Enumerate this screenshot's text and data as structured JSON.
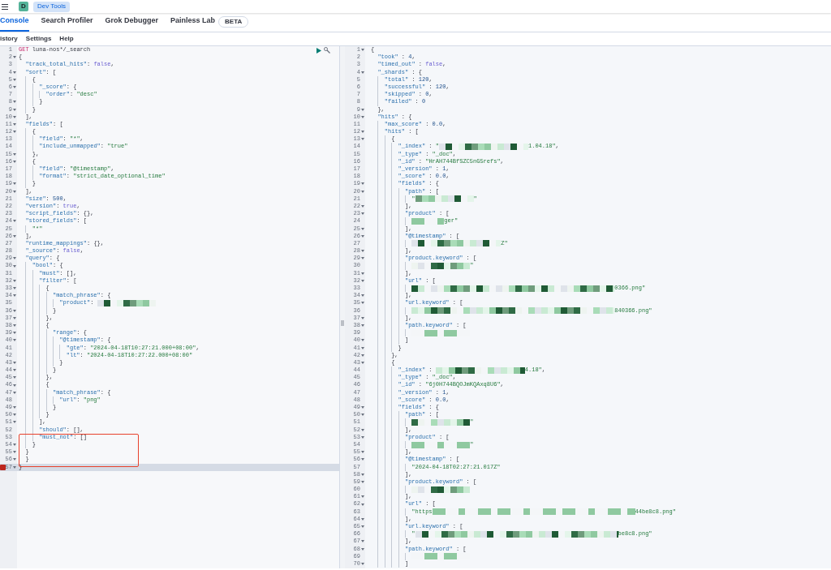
{
  "header": {
    "avatar": "D",
    "breadcrumb": "Dev Tools"
  },
  "tabs": [
    {
      "label": "Console",
      "selected": true
    },
    {
      "label": "Search Profiler",
      "selected": false
    },
    {
      "label": "Grok Debugger",
      "selected": false
    },
    {
      "label": "Painless Lab",
      "selected": false,
      "badge": "BETA"
    }
  ],
  "menu": [
    "istory",
    "Settings",
    "Help"
  ],
  "request_editor": {
    "lines": [
      {
        "n": "1",
        "fold": false,
        "active": false,
        "error": false,
        "boxed": false,
        "tokens": [
          {
            "kind": "meth",
            "text": "GET"
          },
          {
            "kind": "path",
            "text": " luna-nos*/_search"
          }
        ]
      },
      {
        "n": "2",
        "fold": true,
        "active": false,
        "error": false,
        "boxed": false,
        "tokens": [
          {
            "kind": "pun",
            "text": "{"
          }
        ]
      },
      {
        "n": "3",
        "fold": false,
        "active": false,
        "error": false,
        "boxed": false,
        "tokens": [
          {
            "kind": "key",
            "text": "  \"track_total_hits\""
          },
          {
            "kind": "pun",
            "text": ": "
          },
          {
            "kind": "kw",
            "text": "false"
          },
          {
            "kind": "pun",
            "text": ","
          }
        ]
      },
      {
        "n": "4",
        "fold": true,
        "active": false,
        "error": false,
        "boxed": false,
        "tokens": [
          {
            "kind": "key",
            "text": "  \"sort\""
          },
          {
            "kind": "pun",
            "text": ": ["
          }
        ]
      },
      {
        "n": "5",
        "fold": true,
        "active": false,
        "error": false,
        "boxed": false,
        "tokens": [
          {
            "kind": "pun",
            "text": "    {"
          }
        ]
      },
      {
        "n": "6",
        "fold": true,
        "active": false,
        "error": false,
        "boxed": false,
        "tokens": [
          {
            "kind": "key",
            "text": "      \"_score\""
          },
          {
            "kind": "pun",
            "text": ": {"
          }
        ]
      },
      {
        "n": "7",
        "fold": false,
        "active": false,
        "error": false,
        "boxed": false,
        "tokens": [
          {
            "kind": "key",
            "text": "        \"order\""
          },
          {
            "kind": "pun",
            "text": ": "
          },
          {
            "kind": "str",
            "text": "\"desc\""
          }
        ]
      },
      {
        "n": "8",
        "fold": true,
        "active": false,
        "error": false,
        "boxed": false,
        "tokens": [
          {
            "kind": "pun",
            "text": "      }"
          }
        ]
      },
      {
        "n": "9",
        "fold": true,
        "active": false,
        "error": false,
        "boxed": false,
        "tokens": [
          {
            "kind": "pun",
            "text": "    }"
          }
        ]
      },
      {
        "n": "10",
        "fold": true,
        "active": false,
        "error": false,
        "boxed": false,
        "tokens": [
          {
            "kind": "pun",
            "text": "  ],"
          }
        ]
      },
      {
        "n": "11",
        "fold": true,
        "active": false,
        "error": false,
        "boxed": false,
        "tokens": [
          {
            "kind": "key",
            "text": "  \"fields\""
          },
          {
            "kind": "pun",
            "text": ": ["
          }
        ]
      },
      {
        "n": "12",
        "fold": true,
        "active": false,
        "error": false,
        "boxed": false,
        "tokens": [
          {
            "kind": "pun",
            "text": "    {"
          }
        ]
      },
      {
        "n": "13",
        "fold": false,
        "active": false,
        "error": false,
        "boxed": false,
        "tokens": [
          {
            "kind": "key",
            "text": "      \"field\""
          },
          {
            "kind": "pun",
            "text": ": "
          },
          {
            "kind": "str",
            "text": "\"*\""
          },
          {
            "kind": "pun",
            "text": ","
          }
        ]
      },
      {
        "n": "14",
        "fold": false,
        "active": false,
        "error": false,
        "boxed": false,
        "tokens": [
          {
            "kind": "key",
            "text": "      \"include_unmapped\""
          },
          {
            "kind": "pun",
            "text": ": "
          },
          {
            "kind": "str",
            "text": "\"true\""
          }
        ]
      },
      {
        "n": "15",
        "fold": true,
        "active": false,
        "error": false,
        "boxed": false,
        "tokens": [
          {
            "kind": "pun",
            "text": "    },"
          }
        ]
      },
      {
        "n": "16",
        "fold": true,
        "active": false,
        "error": false,
        "boxed": false,
        "tokens": [
          {
            "kind": "pun",
            "text": "    {"
          }
        ]
      },
      {
        "n": "17",
        "fold": false,
        "active": false,
        "error": false,
        "boxed": false,
        "tokens": [
          {
            "kind": "key",
            "text": "      \"field\""
          },
          {
            "kind": "pun",
            "text": ": "
          },
          {
            "kind": "str",
            "text": "\"@timestamp\""
          },
          {
            "kind": "pun",
            "text": ","
          }
        ]
      },
      {
        "n": "18",
        "fold": false,
        "active": false,
        "error": false,
        "boxed": false,
        "tokens": [
          {
            "kind": "key",
            "text": "      \"format\""
          },
          {
            "kind": "pun",
            "text": ": "
          },
          {
            "kind": "str",
            "text": "\"strict_date_optional_time\""
          }
        ]
      },
      {
        "n": "19",
        "fold": true,
        "active": false,
        "error": false,
        "boxed": false,
        "tokens": [
          {
            "kind": "pun",
            "text": "    }"
          }
        ]
      },
      {
        "n": "20",
        "fold": true,
        "active": false,
        "error": false,
        "boxed": false,
        "tokens": [
          {
            "kind": "pun",
            "text": "  ],"
          }
        ]
      },
      {
        "n": "21",
        "fold": false,
        "active": false,
        "error": false,
        "boxed": false,
        "tokens": [
          {
            "kind": "key",
            "text": "  \"size\""
          },
          {
            "kind": "pun",
            "text": ": "
          },
          {
            "kind": "num",
            "text": "500"
          },
          {
            "kind": "pun",
            "text": ","
          }
        ]
      },
      {
        "n": "22",
        "fold": false,
        "active": false,
        "error": false,
        "boxed": false,
        "tokens": [
          {
            "kind": "key",
            "text": "  \"version\""
          },
          {
            "kind": "pun",
            "text": ": "
          },
          {
            "kind": "kw",
            "text": "true"
          },
          {
            "kind": "pun",
            "text": ","
          }
        ]
      },
      {
        "n": "23",
        "fold": false,
        "active": false,
        "error": false,
        "boxed": false,
        "tokens": [
          {
            "kind": "key",
            "text": "  \"script_fields\""
          },
          {
            "kind": "pun",
            "text": ": {},"
          }
        ]
      },
      {
        "n": "24",
        "fold": true,
        "active": false,
        "error": false,
        "boxed": false,
        "tokens": [
          {
            "kind": "key",
            "text": "  \"stored_fields\""
          },
          {
            "kind": "pun",
            "text": ": ["
          }
        ]
      },
      {
        "n": "25",
        "fold": false,
        "active": false,
        "error": false,
        "boxed": false,
        "tokens": [
          {
            "kind": "str",
            "text": "    \"*\""
          }
        ]
      },
      {
        "n": "26",
        "fold": true,
        "active": false,
        "error": false,
        "boxed": false,
        "tokens": [
          {
            "kind": "pun",
            "text": "  ],"
          }
        ]
      },
      {
        "n": "27",
        "fold": false,
        "active": false,
        "error": false,
        "boxed": false,
        "tokens": [
          {
            "kind": "key",
            "text": "  \"runtime_mappings\""
          },
          {
            "kind": "pun",
            "text": ": {},"
          }
        ]
      },
      {
        "n": "28",
        "fold": false,
        "active": false,
        "error": false,
        "boxed": false,
        "tokens": [
          {
            "kind": "key",
            "text": "  \"_source\""
          },
          {
            "kind": "pun",
            "text": ": "
          },
          {
            "kind": "kw",
            "text": "false"
          },
          {
            "kind": "pun",
            "text": ","
          }
        ]
      },
      {
        "n": "29",
        "fold": true,
        "active": false,
        "error": false,
        "boxed": false,
        "tokens": [
          {
            "kind": "key",
            "text": "  \"query\""
          },
          {
            "kind": "pun",
            "text": ": {"
          }
        ]
      },
      {
        "n": "30",
        "fold": true,
        "active": false,
        "error": false,
        "boxed": false,
        "tokens": [
          {
            "kind": "key",
            "text": "    \"bool\""
          },
          {
            "kind": "pun",
            "text": ": {"
          }
        ]
      },
      {
        "n": "31",
        "fold": false,
        "active": false,
        "error": false,
        "boxed": false,
        "tokens": [
          {
            "kind": "key",
            "text": "      \"must\""
          },
          {
            "kind": "pun",
            "text": ": [],"
          }
        ]
      },
      {
        "n": "32",
        "fold": true,
        "active": false,
        "error": false,
        "boxed": false,
        "tokens": [
          {
            "kind": "key",
            "text": "      \"filter\""
          },
          {
            "kind": "pun",
            "text": ": ["
          }
        ]
      },
      {
        "n": "33",
        "fold": true,
        "active": false,
        "error": false,
        "boxed": false,
        "tokens": [
          {
            "kind": "pun",
            "text": "        {"
          }
        ]
      },
      {
        "n": "34",
        "fold": true,
        "active": false,
        "error": false,
        "boxed": false,
        "tokens": [
          {
            "kind": "key",
            "text": "          \"match_phrase\""
          },
          {
            "kind": "pun",
            "text": ": {"
          }
        ]
      },
      {
        "n": "35",
        "fold": false,
        "active": false,
        "error": false,
        "boxed": false,
        "tokens": [
          {
            "kind": "key",
            "text": "            \"product\""
          },
          {
            "kind": "pun",
            "text": ": "
          },
          {
            "kind": "mosaic_medium"
          }
        ]
      },
      {
        "n": "36",
        "fold": true,
        "active": false,
        "error": false,
        "boxed": false,
        "tokens": [
          {
            "kind": "pun",
            "text": "          }"
          }
        ]
      },
      {
        "n": "37",
        "fold": true,
        "active": false,
        "error": false,
        "boxed": false,
        "tokens": [
          {
            "kind": "pun",
            "text": "        },"
          }
        ]
      },
      {
        "n": "38",
        "fold": true,
        "active": false,
        "error": false,
        "boxed": false,
        "tokens": [
          {
            "kind": "pun",
            "text": "        {"
          }
        ]
      },
      {
        "n": "39",
        "fold": true,
        "active": false,
        "error": false,
        "boxed": false,
        "tokens": [
          {
            "kind": "key",
            "text": "          \"range\""
          },
          {
            "kind": "pun",
            "text": ": {"
          }
        ]
      },
      {
        "n": "40",
        "fold": true,
        "active": false,
        "error": false,
        "boxed": false,
        "tokens": [
          {
            "kind": "key",
            "text": "            \"@timestamp\""
          },
          {
            "kind": "pun",
            "text": ": {"
          }
        ]
      },
      {
        "n": "41",
        "fold": false,
        "active": false,
        "error": false,
        "boxed": false,
        "tokens": [
          {
            "kind": "key",
            "text": "              \"gte\""
          },
          {
            "kind": "pun",
            "text": ": "
          },
          {
            "kind": "str",
            "text": "\"2024-04-18T10:27:21.000+08:00\""
          },
          {
            "kind": "pun",
            "text": ","
          }
        ]
      },
      {
        "n": "42",
        "fold": false,
        "active": false,
        "error": false,
        "boxed": false,
        "tokens": [
          {
            "kind": "key",
            "text": "              \"lt\""
          },
          {
            "kind": "pun",
            "text": ": "
          },
          {
            "kind": "str",
            "text": "\"2024-04-18T10:27:22.000+08:00\""
          }
        ]
      },
      {
        "n": "43",
        "fold": true,
        "active": false,
        "error": false,
        "boxed": false,
        "tokens": [
          {
            "kind": "pun",
            "text": "            }"
          }
        ]
      },
      {
        "n": "44",
        "fold": true,
        "active": false,
        "error": false,
        "boxed": false,
        "tokens": [
          {
            "kind": "pun",
            "text": "          }"
          }
        ]
      },
      {
        "n": "45",
        "fold": true,
        "active": false,
        "error": false,
        "boxed": false,
        "tokens": [
          {
            "kind": "pun",
            "text": "        },"
          }
        ]
      },
      {
        "n": "46",
        "fold": true,
        "active": false,
        "error": false,
        "boxed": false,
        "tokens": [
          {
            "kind": "pun",
            "text": "        {"
          }
        ]
      },
      {
        "n": "47",
        "fold": true,
        "active": false,
        "error": false,
        "boxed": false,
        "tokens": [
          {
            "kind": "key",
            "text": "          \"match_phrase\""
          },
          {
            "kind": "pun",
            "text": ": {"
          }
        ]
      },
      {
        "n": "48",
        "fold": false,
        "active": false,
        "error": false,
        "boxed": false,
        "tokens": [
          {
            "kind": "key",
            "text": "            \"url\""
          },
          {
            "kind": "pun",
            "text": ": "
          },
          {
            "kind": "str",
            "text": "\"png\""
          }
        ]
      },
      {
        "n": "49",
        "fold": true,
        "active": false,
        "error": false,
        "boxed": false,
        "tokens": [
          {
            "kind": "pun",
            "text": "          }"
          }
        ]
      },
      {
        "n": "50",
        "fold": true,
        "active": false,
        "error": false,
        "boxed": false,
        "tokens": [
          {
            "kind": "pun",
            "text": "        }"
          }
        ]
      },
      {
        "n": "51",
        "fold": true,
        "active": false,
        "error": false,
        "boxed": false,
        "tokens": [
          {
            "kind": "pun",
            "text": "      ],"
          }
        ]
      },
      {
        "n": "52",
        "fold": false,
        "active": false,
        "error": false,
        "boxed": false,
        "tokens": [
          {
            "kind": "key",
            "text": "      \"should\""
          },
          {
            "kind": "pun",
            "text": ": [],"
          }
        ]
      },
      {
        "n": "53",
        "fold": false,
        "active": false,
        "error": false,
        "boxed": true,
        "tokens": [
          {
            "kind": "key",
            "text": "      \"must_not\""
          },
          {
            "kind": "pun",
            "text": ": []"
          }
        ]
      },
      {
        "n": "54",
        "fold": true,
        "active": false,
        "error": false,
        "boxed": true,
        "tokens": [
          {
            "kind": "pun",
            "text": "    }"
          }
        ]
      },
      {
        "n": "55",
        "fold": true,
        "active": false,
        "error": false,
        "boxed": true,
        "tokens": [
          {
            "kind": "pun",
            "text": "  }"
          }
        ]
      },
      {
        "n": "56",
        "fold": true,
        "active": false,
        "error": false,
        "boxed": true,
        "tokens": [
          {
            "kind": "pun",
            "text": "  }"
          }
        ]
      },
      {
        "n": "57",
        "fold": true,
        "active": true,
        "error": true,
        "boxed": false,
        "tokens": [
          {
            "kind": "pun",
            "text": "}"
          }
        ]
      }
    ]
  },
  "response_editor": {
    "lines": [
      {
        "n": "1",
        "fold": true,
        "tokens": [
          {
            "kind": "pun",
            "text": "{"
          }
        ]
      },
      {
        "n": "2",
        "fold": false,
        "tokens": [
          {
            "kind": "key",
            "text": "  \"took\""
          },
          {
            "kind": "pun",
            "text": " : "
          },
          {
            "kind": "num",
            "text": "4"
          },
          {
            "kind": "pun",
            "text": ","
          }
        ]
      },
      {
        "n": "3",
        "fold": false,
        "tokens": [
          {
            "kind": "key",
            "text": "  \"timed_out\""
          },
          {
            "kind": "pun",
            "text": " : "
          },
          {
            "kind": "kw",
            "text": "false"
          },
          {
            "kind": "pun",
            "text": ","
          }
        ]
      },
      {
        "n": "4",
        "fold": true,
        "tokens": [
          {
            "kind": "key",
            "text": "  \"_shards\""
          },
          {
            "kind": "pun",
            "text": " : {"
          }
        ]
      },
      {
        "n": "5",
        "fold": false,
        "tokens": [
          {
            "kind": "key",
            "text": "    \"total\""
          },
          {
            "kind": "pun",
            "text": " : "
          },
          {
            "kind": "num",
            "text": "120"
          },
          {
            "kind": "pun",
            "text": ","
          }
        ]
      },
      {
        "n": "6",
        "fold": false,
        "tokens": [
          {
            "kind": "key",
            "text": "    \"successful\""
          },
          {
            "kind": "pun",
            "text": " : "
          },
          {
            "kind": "num",
            "text": "120"
          },
          {
            "kind": "pun",
            "text": ","
          }
        ]
      },
      {
        "n": "7",
        "fold": false,
        "tokens": [
          {
            "kind": "key",
            "text": "    \"skipped\""
          },
          {
            "kind": "pun",
            "text": " : "
          },
          {
            "kind": "num",
            "text": "0"
          },
          {
            "kind": "pun",
            "text": ","
          }
        ]
      },
      {
        "n": "8",
        "fold": false,
        "tokens": [
          {
            "kind": "key",
            "text": "    \"failed\""
          },
          {
            "kind": "pun",
            "text": " : "
          },
          {
            "kind": "num",
            "text": "0"
          }
        ]
      },
      {
        "n": "9",
        "fold": true,
        "tokens": [
          {
            "kind": "pun",
            "text": "  },"
          }
        ]
      },
      {
        "n": "10",
        "fold": true,
        "tokens": [
          {
            "kind": "key",
            "text": "  \"hits\""
          },
          {
            "kind": "pun",
            "text": " : {"
          }
        ]
      },
      {
        "n": "11",
        "fold": false,
        "tokens": [
          {
            "kind": "key",
            "text": "    \"max_score\""
          },
          {
            "kind": "pun",
            "text": " : "
          },
          {
            "kind": "num",
            "text": "0.0"
          },
          {
            "kind": "pun",
            "text": ","
          }
        ]
      },
      {
        "n": "12",
        "fold": true,
        "tokens": [
          {
            "kind": "key",
            "text": "    \"hits\""
          },
          {
            "kind": "pun",
            "text": " : ["
          }
        ]
      },
      {
        "n": "13",
        "fold": true,
        "tokens": [
          {
            "kind": "pun",
            "text": "      {"
          }
        ]
      },
      {
        "n": "14",
        "fold": false,
        "tokens": [
          {
            "kind": "key",
            "text": "        \"_index\""
          },
          {
            "kind": "pun",
            "text": " : "
          },
          {
            "kind": "str",
            "text": "\""
          },
          {
            "kind": "mosaic_wide"
          },
          {
            "kind": "str",
            "text": "1.04.18\""
          },
          {
            "kind": "pun",
            "text": ","
          }
        ]
      },
      {
        "n": "15",
        "fold": false,
        "tokens": [
          {
            "kind": "key",
            "text": "        \"_type\""
          },
          {
            "kind": "pun",
            "text": " : "
          },
          {
            "kind": "str",
            "text": "\"_doc\""
          },
          {
            "kind": "pun",
            "text": ","
          }
        ]
      },
      {
        "n": "16",
        "fold": false,
        "tokens": [
          {
            "kind": "key",
            "text": "        \"_id\""
          },
          {
            "kind": "pun",
            "text": " : "
          },
          {
            "kind": "str",
            "text": "\"HrAH744BfSZC5nG5refs\""
          },
          {
            "kind": "pun",
            "text": ","
          }
        ]
      },
      {
        "n": "17",
        "fold": false,
        "tokens": [
          {
            "kind": "key",
            "text": "        \"_version\""
          },
          {
            "kind": "pun",
            "text": " : "
          },
          {
            "kind": "num",
            "text": "1"
          },
          {
            "kind": "pun",
            "text": ","
          }
        ]
      },
      {
        "n": "18",
        "fold": false,
        "tokens": [
          {
            "kind": "key",
            "text": "        \"_score\""
          },
          {
            "kind": "pun",
            "text": " : "
          },
          {
            "kind": "num",
            "text": "0.0"
          },
          {
            "kind": "pun",
            "text": ","
          }
        ]
      },
      {
        "n": "19",
        "fold": true,
        "tokens": [
          {
            "kind": "key",
            "text": "        \"fields\""
          },
          {
            "kind": "pun",
            "text": " : {"
          }
        ]
      },
      {
        "n": "20",
        "fold": true,
        "tokens": [
          {
            "kind": "key",
            "text": "          \"path\""
          },
          {
            "kind": "pun",
            "text": " : ["
          }
        ]
      },
      {
        "n": "21",
        "fold": false,
        "tokens": [
          {
            "kind": "str",
            "text": "            \""
          },
          {
            "kind": "mosaic_medium"
          },
          {
            "kind": "str",
            "text": "\""
          }
        ]
      },
      {
        "n": "22",
        "fold": true,
        "tokens": [
          {
            "kind": "pun",
            "text": "          ],"
          }
        ]
      },
      {
        "n": "23",
        "fold": true,
        "tokens": [
          {
            "kind": "key",
            "text": "          \"product\""
          },
          {
            "kind": "pun",
            "text": " : ["
          }
        ]
      },
      {
        "n": "24",
        "fold": false,
        "tokens": [
          {
            "kind": "mosaic_short"
          },
          {
            "kind": "str",
            "text": "ger\""
          }
        ]
      },
      {
        "n": "25",
        "fold": true,
        "tokens": [
          {
            "kind": "pun",
            "text": "          ],"
          }
        ]
      },
      {
        "n": "26",
        "fold": true,
        "tokens": [
          {
            "kind": "key",
            "text": "          \"@timestamp\""
          },
          {
            "kind": "pun",
            "text": " : ["
          }
        ]
      },
      {
        "n": "27",
        "fold": false,
        "tokens": [
          {
            "kind": "mosaic_wide"
          },
          {
            "kind": "str",
            "text": "Z\""
          }
        ]
      },
      {
        "n": "28",
        "fold": true,
        "tokens": [
          {
            "kind": "pun",
            "text": "          ],"
          }
        ]
      },
      {
        "n": "29",
        "fold": true,
        "tokens": [
          {
            "kind": "key",
            "text": "          \"product.keyword\""
          },
          {
            "kind": "pun",
            "text": " : ["
          }
        ]
      },
      {
        "n": "30",
        "fold": false,
        "tokens": [
          {
            "kind": "mosaic_medium"
          },
          {
            "kind": "str",
            "text": "\""
          }
        ]
      },
      {
        "n": "31",
        "fold": true,
        "tokens": [
          {
            "kind": "pun",
            "text": "          ],"
          }
        ]
      },
      {
        "n": "32",
        "fold": true,
        "tokens": [
          {
            "kind": "key",
            "text": "          \"url\""
          },
          {
            "kind": "pun",
            "text": " : ["
          }
        ]
      },
      {
        "n": "33",
        "fold": false,
        "tokens": [
          {
            "kind": "mosaic_long"
          },
          {
            "kind": "str",
            "text": "0366.png\""
          }
        ]
      },
      {
        "n": "34",
        "fold": true,
        "tokens": [
          {
            "kind": "pun",
            "text": "          ],"
          }
        ]
      },
      {
        "n": "35",
        "fold": true,
        "tokens": [
          {
            "kind": "key",
            "text": "          \"url.keyword\""
          },
          {
            "kind": "pun",
            "text": " : ["
          }
        ]
      },
      {
        "n": "36",
        "fold": false,
        "tokens": [
          {
            "kind": "mosaic_long"
          },
          {
            "kind": "str",
            "text": "840366.png\""
          }
        ]
      },
      {
        "n": "37",
        "fold": true,
        "tokens": [
          {
            "kind": "pun",
            "text": "          ],"
          }
        ]
      },
      {
        "n": "38",
        "fold": true,
        "tokens": [
          {
            "kind": "key",
            "text": "          \"path.keyword\""
          },
          {
            "kind": "pun",
            "text": " : ["
          }
        ]
      },
      {
        "n": "39",
        "fold": false,
        "tokens": [
          {
            "kind": "mosaic_medium"
          }
        ]
      },
      {
        "n": "40",
        "fold": true,
        "tokens": [
          {
            "kind": "pun",
            "text": "          ]"
          }
        ]
      },
      {
        "n": "41",
        "fold": true,
        "tokens": [
          {
            "kind": "pun",
            "text": "        }"
          }
        ]
      },
      {
        "n": "42",
        "fold": true,
        "tokens": [
          {
            "kind": "pun",
            "text": "      },"
          }
        ]
      },
      {
        "n": "43",
        "fold": true,
        "tokens": [
          {
            "kind": "pun",
            "text": "      {"
          }
        ]
      },
      {
        "n": "44",
        "fold": false,
        "tokens": [
          {
            "kind": "key",
            "text": "        \"_index\""
          },
          {
            "kind": "pun",
            "text": " : "
          },
          {
            "kind": "mosaic_wide"
          },
          {
            "kind": "str",
            "text": "4.18\""
          },
          {
            "kind": "pun",
            "text": ","
          }
        ]
      },
      {
        "n": "45",
        "fold": false,
        "tokens": [
          {
            "kind": "key",
            "text": "        \"_type\""
          },
          {
            "kind": "pun",
            "text": " : "
          },
          {
            "kind": "str",
            "text": "\"_doc\""
          },
          {
            "kind": "pun",
            "text": ","
          }
        ]
      },
      {
        "n": "46",
        "fold": false,
        "tokens": [
          {
            "kind": "key",
            "text": "        \"_id\""
          },
          {
            "kind": "pun",
            "text": " : "
          },
          {
            "kind": "str",
            "text": "\"6j0H744BQOJmKQAxq8U6\""
          },
          {
            "kind": "pun",
            "text": ","
          }
        ]
      },
      {
        "n": "47",
        "fold": false,
        "tokens": [
          {
            "kind": "key",
            "text": "        \"_version\""
          },
          {
            "kind": "pun",
            "text": " : "
          },
          {
            "kind": "num",
            "text": "1"
          },
          {
            "kind": "pun",
            "text": ","
          }
        ]
      },
      {
        "n": "48",
        "fold": false,
        "tokens": [
          {
            "kind": "key",
            "text": "        \"_score\""
          },
          {
            "kind": "pun",
            "text": " : "
          },
          {
            "kind": "num",
            "text": "0.0"
          },
          {
            "kind": "pun",
            "text": ","
          }
        ]
      },
      {
        "n": "49",
        "fold": true,
        "tokens": [
          {
            "kind": "key",
            "text": "        \"fields\""
          },
          {
            "kind": "pun",
            "text": " : {"
          }
        ]
      },
      {
        "n": "50",
        "fold": true,
        "tokens": [
          {
            "kind": "key",
            "text": "          \"path\""
          },
          {
            "kind": "pun",
            "text": " : ["
          }
        ]
      },
      {
        "n": "51",
        "fold": false,
        "tokens": [
          {
            "kind": "mosaic_medium"
          },
          {
            "kind": "str",
            "text": "\""
          }
        ]
      },
      {
        "n": "52",
        "fold": true,
        "tokens": [
          {
            "kind": "pun",
            "text": "          ],"
          }
        ]
      },
      {
        "n": "53",
        "fold": true,
        "tokens": [
          {
            "kind": "key",
            "text": "          \"product\""
          },
          {
            "kind": "pun",
            "text": " : ["
          }
        ]
      },
      {
        "n": "54",
        "fold": false,
        "tokens": [
          {
            "kind": "mosaic_medium"
          },
          {
            "kind": "str",
            "text": "\""
          }
        ]
      },
      {
        "n": "55",
        "fold": true,
        "tokens": [
          {
            "kind": "pun",
            "text": "          ],"
          }
        ]
      },
      {
        "n": "56",
        "fold": true,
        "tokens": [
          {
            "kind": "key",
            "text": "          \"@timestamp\""
          },
          {
            "kind": "pun",
            "text": " : ["
          }
        ]
      },
      {
        "n": "57",
        "fold": false,
        "tokens": [
          {
            "kind": "str",
            "text": "            \"2024-04-18T02:27:21.017Z\""
          }
        ]
      },
      {
        "n": "58",
        "fold": true,
        "tokens": [
          {
            "kind": "pun",
            "text": "          ],"
          }
        ]
      },
      {
        "n": "59",
        "fold": true,
        "tokens": [
          {
            "kind": "key",
            "text": "          \"product.keyword\""
          },
          {
            "kind": "pun",
            "text": " : ["
          }
        ]
      },
      {
        "n": "60",
        "fold": false,
        "tokens": [
          {
            "kind": "mosaic_medium"
          }
        ]
      },
      {
        "n": "61",
        "fold": true,
        "tokens": [
          {
            "kind": "pun",
            "text": "          ],"
          }
        ]
      },
      {
        "n": "62",
        "fold": true,
        "tokens": [
          {
            "kind": "key",
            "text": "          \"url\""
          },
          {
            "kind": "pun",
            "text": " : ["
          }
        ]
      },
      {
        "n": "63",
        "fold": false,
        "tokens": [
          {
            "kind": "str",
            "text": "            \"https"
          },
          {
            "kind": "mosaic_long"
          },
          {
            "kind": "str",
            "text": "44be8c8.png\""
          }
        ]
      },
      {
        "n": "64",
        "fold": true,
        "tokens": [
          {
            "kind": "pun",
            "text": "          ],"
          }
        ]
      },
      {
        "n": "65",
        "fold": true,
        "tokens": [
          {
            "kind": "key",
            "text": "          \"url.keyword\""
          },
          {
            "kind": "pun",
            "text": " : ["
          }
        ]
      },
      {
        "n": "66",
        "fold": false,
        "tokens": [
          {
            "kind": "str",
            "text": "            \""
          },
          {
            "kind": "mosaic_long"
          },
          {
            "kind": "str",
            "text": "be8c8.png\""
          }
        ]
      },
      {
        "n": "67",
        "fold": true,
        "tokens": [
          {
            "kind": "pun",
            "text": "          ],"
          }
        ]
      },
      {
        "n": "68",
        "fold": true,
        "tokens": [
          {
            "kind": "key",
            "text": "          \"path.keyword\""
          },
          {
            "kind": "pun",
            "text": " : ["
          }
        ]
      },
      {
        "n": "69",
        "fold": false,
        "tokens": [
          {
            "kind": "mosaic_medium"
          }
        ]
      },
      {
        "n": "70",
        "fold": true,
        "tokens": [
          {
            "kind": "pun",
            "text": "          ]"
          }
        ]
      }
    ]
  }
}
